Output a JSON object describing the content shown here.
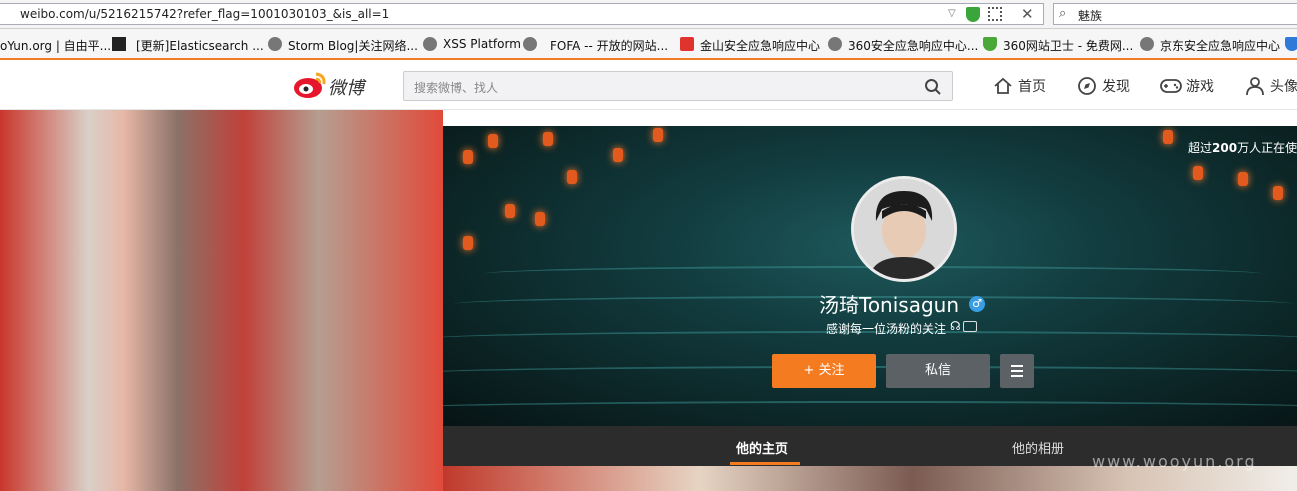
{
  "browser": {
    "url": "weibo.com/u/5216215742?refer_flag=1001030103_&is_all=1",
    "search_value": "魅族"
  },
  "bookmarks": [
    "oYun.org | 自由平...",
    "[更新]Elasticsearch ...",
    "Storm Blog|关注网络...",
    "XSS Platform",
    "FOFA -- 开放的网站...",
    "金山安全应急响应中心",
    "360安全应急响应中心...",
    "360网站卫士 - 免费网...",
    "京东安全应急响应中心"
  ],
  "header": {
    "logo_text": "微博",
    "search_placeholder": "搜索微博、找人",
    "nav": [
      "首页",
      "发现",
      "游戏",
      "头像"
    ]
  },
  "profile": {
    "name": "汤琦Tonisagun",
    "bio": "感谢每一位汤粉的关注",
    "follow_label": "+ 关注",
    "message_label": "私信",
    "users_note_prefix": "超过",
    "users_note_number": "200",
    "users_note_suffix": "万人正在使"
  },
  "tabs": [
    "他的主页",
    "他的相册"
  ],
  "watermark": "www.wooyun.org",
  "colors": {
    "accent_orange": "#f57b20",
    "button_gray": "#5c6165",
    "tab_bar": "#2c2c2c"
  }
}
